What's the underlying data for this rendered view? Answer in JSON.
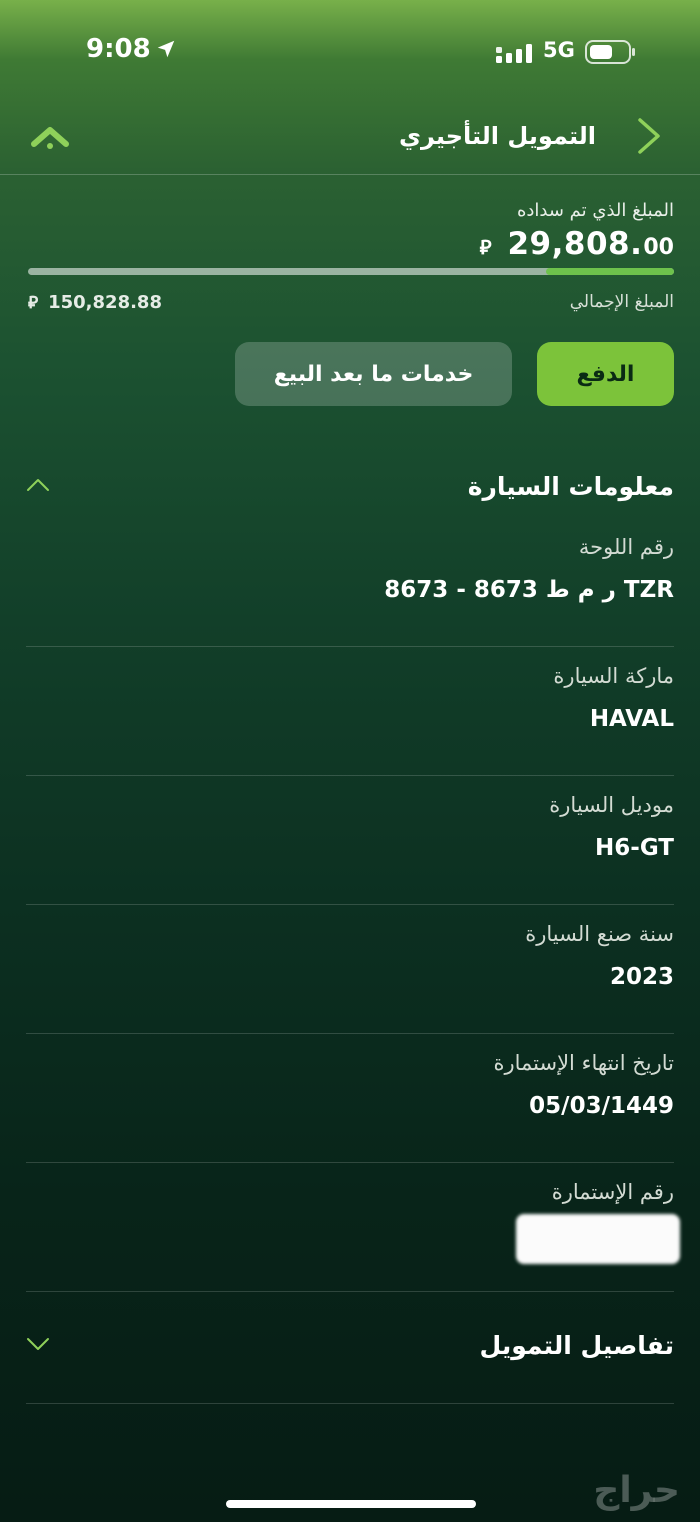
{
  "status_bar": {
    "time": "9:08",
    "network": "5G"
  },
  "header": {
    "title": "التمويل التأجيري"
  },
  "financing": {
    "paid_label": "المبلغ الذي تم سداده",
    "paid_amount_main": "29,808.",
    "paid_amount_decimal": "00",
    "currency_symbol": "⃁",
    "total_label": "المبلغ الإجمالي",
    "total_amount": "150,828.88",
    "paid_fraction": 0.198
  },
  "actions": {
    "pay_label": "الدفع",
    "after_sales_label": "خدمات ما بعد البيع"
  },
  "car_info": {
    "title": "معلومات السيارة",
    "fields": [
      {
        "label": "رقم اللوحة",
        "value": "ر م ط 8673 - 8673 TZR"
      },
      {
        "label": "ماركة السيارة",
        "value": "HAVAL"
      },
      {
        "label": "موديل السيارة",
        "value": "H6-GT"
      },
      {
        "label": "سنة صنع السيارة",
        "value": "2023"
      },
      {
        "label": "تاريخ انتهاء الإستمارة",
        "value": "05/03/1449"
      },
      {
        "label": "رقم الإستمارة",
        "value": ""
      }
    ]
  },
  "finance_details": {
    "title": "تفاصيل التمويل"
  },
  "watermark": "حراج",
  "colors": {
    "accent": "#7cc33a",
    "progress": "#6ec24c",
    "chevron": "#8fd15a"
  }
}
